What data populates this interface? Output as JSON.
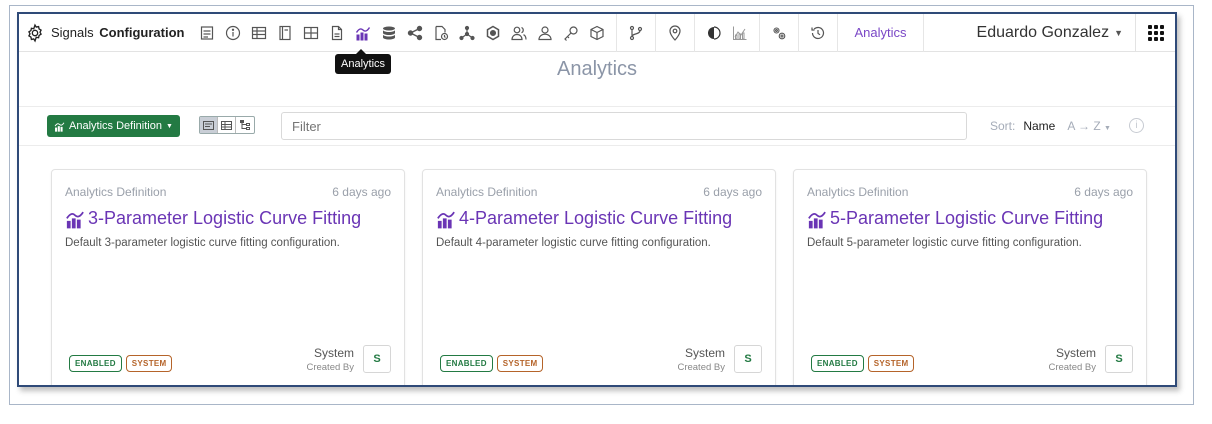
{
  "header": {
    "brand_light": "Signals",
    "brand_bold": "Configuration",
    "active_nav": "Analytics",
    "user_name": "Eduardo Gonzalez",
    "toolbar_icons": [
      "document-icon",
      "info-icon",
      "table-icon",
      "notebook-icon",
      "grid-icon",
      "file-icon",
      "analytics-icon",
      "database-icon",
      "share-icon",
      "file-clock-icon",
      "hierarchy-icon",
      "hexagon-icon",
      "user-group-icon",
      "user-icon",
      "key-icon",
      "cube-icon",
      "branch-icon",
      "location-icon",
      "contrast-icon",
      "chart-icon",
      "gears-icon",
      "history-icon"
    ]
  },
  "tooltip": "Analytics",
  "page": {
    "title": "Analytics"
  },
  "toolbar": {
    "definition_button": "Analytics Definition",
    "filter_placeholder": "Filter",
    "sort_label": "Sort:",
    "sort_value": "Name",
    "sort_direction": "A → Z",
    "info": "i"
  },
  "cards": [
    {
      "type": "Analytics Definition",
      "time": "6 days ago",
      "title": "3-Parameter Logistic Curve Fitting",
      "description": "Default 3-parameter logistic curve fitting configuration.",
      "badge_enabled": "ENABLED",
      "badge_system": "SYSTEM",
      "author": "System",
      "created_by": "Created By",
      "avatar": "S"
    },
    {
      "type": "Analytics Definition",
      "time": "6 days ago",
      "title": "4-Parameter Logistic Curve Fitting",
      "description": "Default 4-parameter logistic curve fitting configuration.",
      "badge_enabled": "ENABLED",
      "badge_system": "SYSTEM",
      "author": "System",
      "created_by": "Created By",
      "avatar": "S"
    },
    {
      "type": "Analytics Definition",
      "time": "6 days ago",
      "title": "5-Parameter Logistic Curve Fitting",
      "description": "Default 5-parameter logistic curve fitting configuration.",
      "badge_enabled": "ENABLED",
      "badge_system": "SYSTEM",
      "author": "System",
      "created_by": "Created By",
      "avatar": "S"
    }
  ],
  "colors": {
    "accent": "#6a35b5",
    "green": "#237a43",
    "system": "#b5642a",
    "frame": "#2f4a78"
  }
}
